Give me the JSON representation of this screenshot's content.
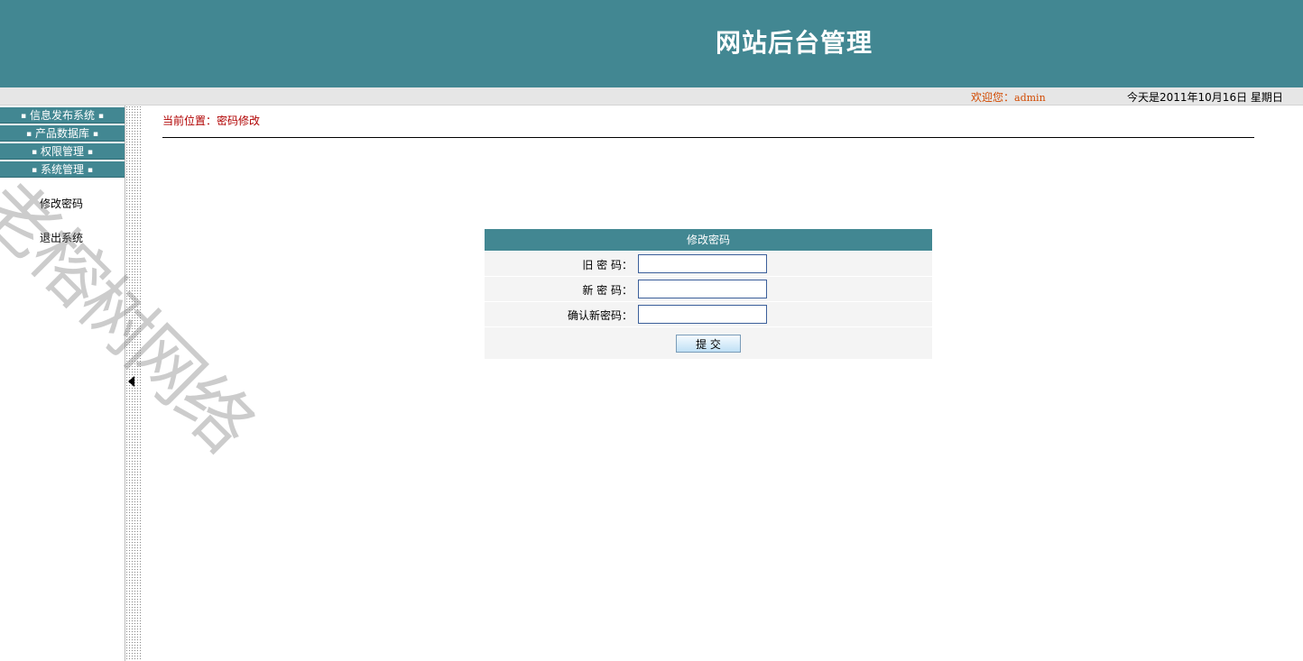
{
  "header": {
    "title": "网站后台管理"
  },
  "status_bar": {
    "welcome_label": "欢迎您：",
    "user": "admin",
    "date": "今天是2011年10月16日  星期日"
  },
  "sidebar": {
    "menus": [
      {
        "label": "信息发布系统"
      },
      {
        "label": "产品数据库"
      },
      {
        "label": "权限管理"
      },
      {
        "label": "系统管理"
      }
    ],
    "links": [
      {
        "label": "修改密码"
      },
      {
        "label": "退出系统"
      }
    ]
  },
  "breadcrumb": "当前位置：密码修改",
  "form": {
    "title": "修改密码",
    "fields": [
      {
        "label": "旧  密  码：",
        "value": ""
      },
      {
        "label": "新  密  码：",
        "value": ""
      },
      {
        "label": "确认新密码：",
        "value": ""
      }
    ],
    "submit_label": "提 交"
  },
  "watermark": "老榕树网络",
  "colors": {
    "brand": "#428792",
    "breadcrumb": "#b00000",
    "welcome": "#d24a00"
  }
}
